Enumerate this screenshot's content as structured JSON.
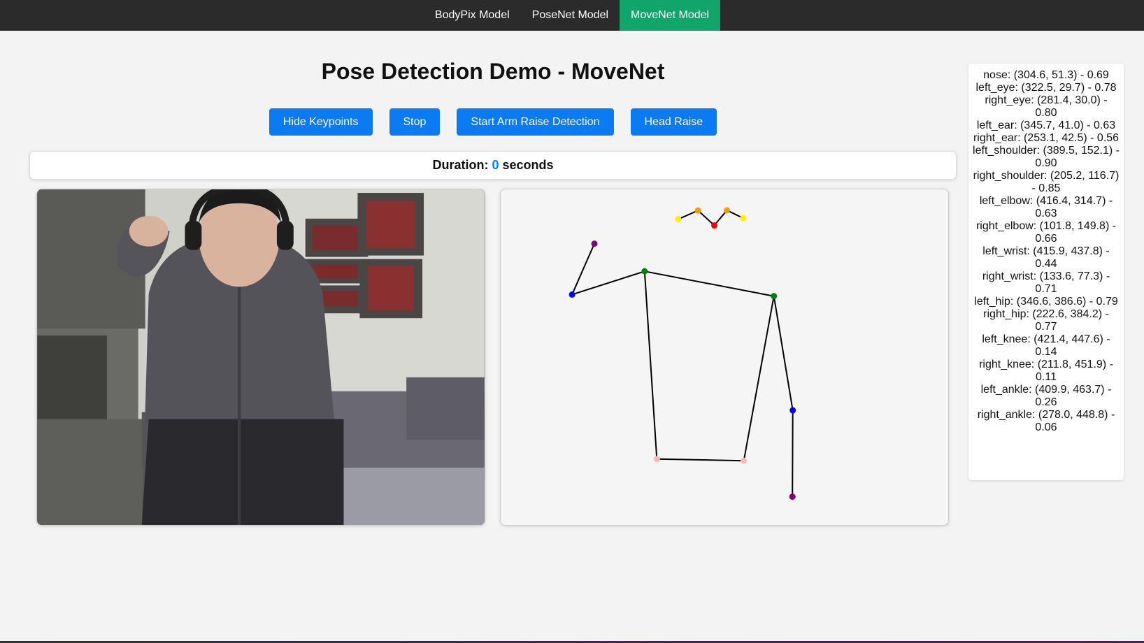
{
  "nav": {
    "items": [
      {
        "label": "BodyPix Model",
        "active": false
      },
      {
        "label": "PoseNet Model",
        "active": false
      },
      {
        "label": "MoveNet Model",
        "active": true
      }
    ],
    "active_color": "#12a56a"
  },
  "title": "Pose Detection Demo - MoveNet",
  "buttons": {
    "hide_keypoints": "Hide Keypoints",
    "stop": "Stop",
    "arm_raise": "Start Arm Raise Detection",
    "head_raise": "Head Raise"
  },
  "duration": {
    "label": "Duration:",
    "value": "0",
    "unit": "seconds"
  },
  "keypoints": [
    {
      "name": "nose",
      "x": 304.6,
      "y": 51.3,
      "score": 0.69,
      "text": "nose: (304.6, 51.3) - 0.69"
    },
    {
      "name": "left_eye",
      "x": 322.5,
      "y": 29.7,
      "score": 0.78,
      "text": "left_eye: (322.5, 29.7) - 0.78"
    },
    {
      "name": "right_eye",
      "x": 281.4,
      "y": 30.0,
      "score": 0.8,
      "text": "right_eye: (281.4, 30.0) - 0.80"
    },
    {
      "name": "left_ear",
      "x": 345.7,
      "y": 41.0,
      "score": 0.63,
      "text": "left_ear: (345.7, 41.0) - 0.63"
    },
    {
      "name": "right_ear",
      "x": 253.1,
      "y": 42.5,
      "score": 0.56,
      "text": "right_ear: (253.1, 42.5) - 0.56"
    },
    {
      "name": "left_shoulder",
      "x": 389.5,
      "y": 152.1,
      "score": 0.9,
      "text": "left_shoulder: (389.5, 152.1) - 0.90"
    },
    {
      "name": "right_shoulder",
      "x": 205.2,
      "y": 116.7,
      "score": 0.85,
      "text": "right_shoulder: (205.2, 116.7) - 0.85"
    },
    {
      "name": "left_elbow",
      "x": 416.4,
      "y": 314.7,
      "score": 0.63,
      "text": "left_elbow: (416.4, 314.7) - 0.63"
    },
    {
      "name": "right_elbow",
      "x": 101.8,
      "y": 149.8,
      "score": 0.66,
      "text": "right_elbow: (101.8, 149.8) - 0.66"
    },
    {
      "name": "left_wrist",
      "x": 415.9,
      "y": 437.8,
      "score": 0.44,
      "text": "left_wrist: (415.9, 437.8) - 0.44"
    },
    {
      "name": "right_wrist",
      "x": 133.6,
      "y": 77.3,
      "score": 0.71,
      "text": "right_wrist: (133.6, 77.3) - 0.71"
    },
    {
      "name": "left_hip",
      "x": 346.6,
      "y": 386.6,
      "score": 0.79,
      "text": "left_hip: (346.6, 386.6) - 0.79"
    },
    {
      "name": "right_hip",
      "x": 222.6,
      "y": 384.2,
      "score": 0.77,
      "text": "right_hip: (222.6, 384.2) - 0.77"
    },
    {
      "name": "left_knee",
      "x": 421.4,
      "y": 447.6,
      "score": 0.14,
      "text": "left_knee: (421.4, 447.6) - 0.14"
    },
    {
      "name": "right_knee",
      "x": 211.8,
      "y": 451.9,
      "score": 0.11,
      "text": "right_knee: (211.8, 451.9) - 0.11"
    },
    {
      "name": "left_ankle",
      "x": 409.9,
      "y": 463.7,
      "score": 0.26,
      "text": "left_ankle: (409.9, 463.7) - 0.26"
    },
    {
      "name": "right_ankle",
      "x": 278.0,
      "y": 448.8,
      "score": 0.06,
      "text": "right_ankle: (278.0, 448.8) - 0.06"
    }
  ],
  "colors": {
    "accent": "#0b7bf4",
    "nose": "#ff0000",
    "eyes": "#ff9900",
    "ears": "#ffee00",
    "shoulders": "#008000",
    "elbows": "#0000ff",
    "wrists": "#800080",
    "hips": "#ffb6c1",
    "skeleton_line": "#000000"
  }
}
